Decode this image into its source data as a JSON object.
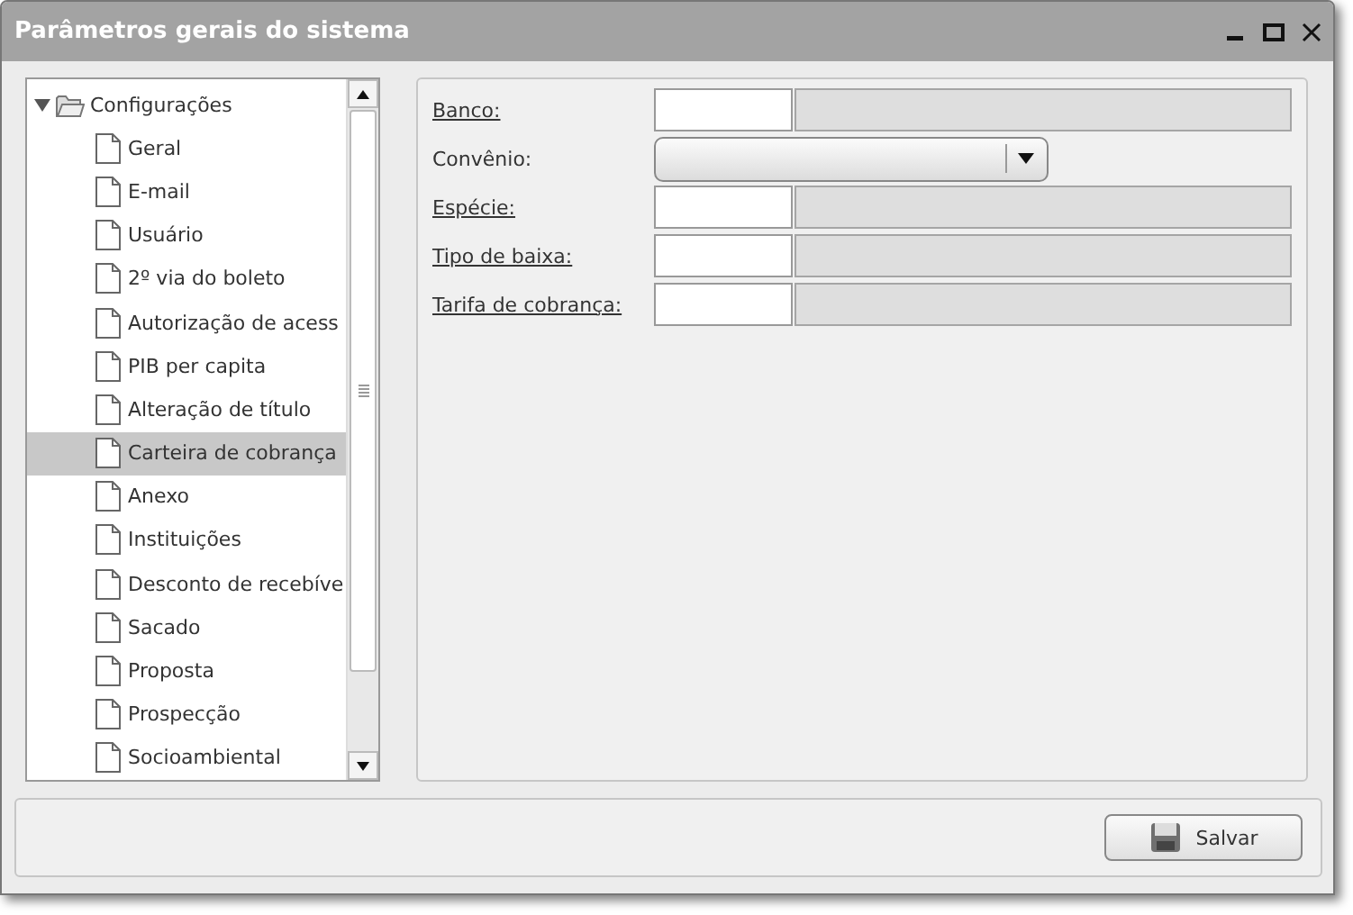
{
  "window": {
    "title": "Parâmetros gerais do sistema"
  },
  "tree": {
    "label": "Configurações",
    "expanded": true,
    "children": [
      {
        "label": "Geral",
        "selected": false
      },
      {
        "label": "E-mail",
        "selected": false
      },
      {
        "label": "Usuário",
        "selected": false
      },
      {
        "label": "2º via do boleto",
        "selected": false
      },
      {
        "label": "Autorização de acess",
        "selected": false
      },
      {
        "label": "PIB per capita",
        "selected": false
      },
      {
        "label": "Alteração de título",
        "selected": false
      },
      {
        "label": "Carteira de cobrança",
        "selected": true
      },
      {
        "label": "Anexo",
        "selected": false
      },
      {
        "label": "Instituições",
        "selected": false
      },
      {
        "label": "Desconto de recebíve",
        "selected": false
      },
      {
        "label": "Sacado",
        "selected": false
      },
      {
        "label": "Proposta",
        "selected": false
      },
      {
        "label": "Prospecção",
        "selected": false
      },
      {
        "label": "Socioambiental",
        "selected": false
      }
    ]
  },
  "form": {
    "fields": [
      {
        "label": "Banco:",
        "kind": "lookup"
      },
      {
        "label": "Convênio:",
        "kind": "select"
      },
      {
        "label": "Espécie:",
        "kind": "lookup"
      },
      {
        "label": "Tipo de baixa:",
        "kind": "lookup"
      },
      {
        "label": "Tarifa de cobrança:",
        "kind": "lookup"
      }
    ]
  },
  "buttons": [
    {
      "label": "Salvar"
    }
  ]
}
